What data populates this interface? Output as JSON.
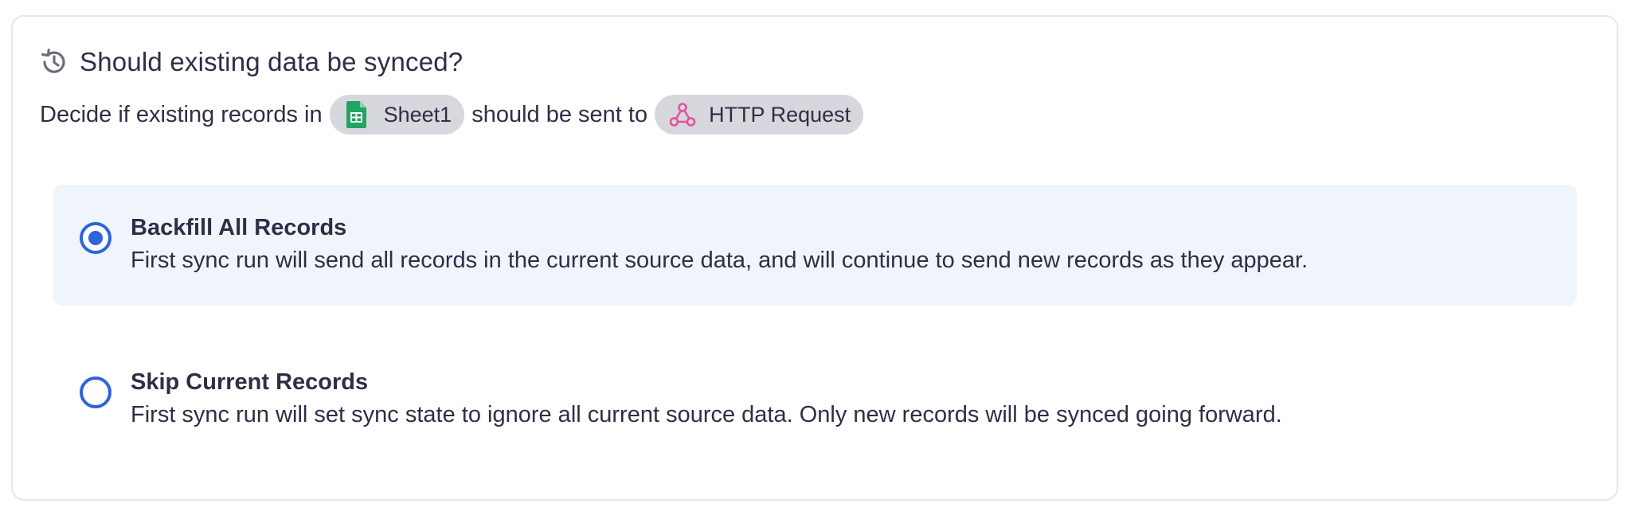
{
  "heading": {
    "icon": "history-icon",
    "title": "Should existing data be synced?"
  },
  "description": {
    "prefix": "Decide if existing records in",
    "source": {
      "icon": "google-sheets-icon",
      "label": "Sheet1",
      "icon_color": "#21a464"
    },
    "middle": "should be sent to",
    "destination": {
      "icon": "webhook-icon",
      "label": "HTTP Request",
      "icon_color": "#e8519a"
    }
  },
  "options": [
    {
      "title": "Backfill All Records",
      "description": "First sync run will send all records in the current source data, and will continue to send new records as they appear.",
      "selected": true
    },
    {
      "title": "Skip Current Records",
      "description": "First sync run will set sync state to ignore all current source data. Only new records will be synced going forward.",
      "selected": false
    }
  ],
  "colors": {
    "accent": "#2e63dc",
    "selected_bg": "#f0f5fc",
    "pill_bg": "#d7d7de",
    "text": "#2d2f45"
  }
}
